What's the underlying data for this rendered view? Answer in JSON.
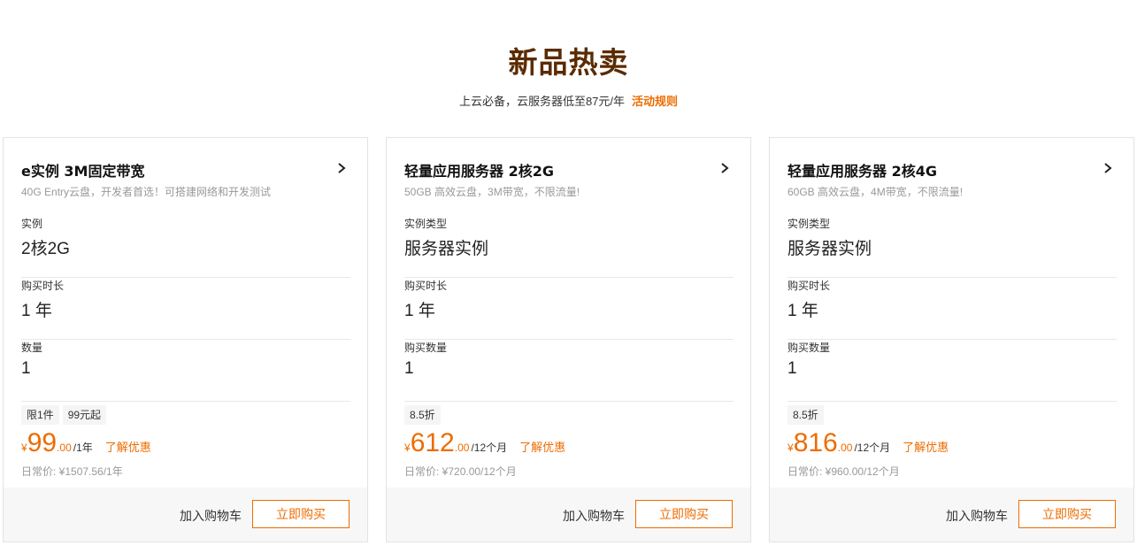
{
  "header": {
    "title": "新品热卖",
    "subtitle": "上云必备，云服务器低至87元/年",
    "rules_link": "活动规则"
  },
  "colors": {
    "accent": "#ed6c00",
    "title": "#5b2b00"
  },
  "cards": [
    {
      "title": "e实例 3M固定带宽",
      "desc": "40G Entry云盘，开发者首选！可搭建网络和开发测试",
      "fields": [
        {
          "label": "实例",
          "value": "2核2G"
        },
        {
          "label": "购买时长",
          "value": "1 年"
        },
        {
          "label": "数量",
          "value": "1"
        }
      ],
      "tags": [
        "限1件",
        "99元起"
      ],
      "price": {
        "symbol": "¥",
        "integer": "99",
        "decimal": ".00",
        "unit": "/1年"
      },
      "promo": "了解优惠",
      "regular": "日常价: ¥1507.56/1年",
      "cart": "加入购物车",
      "buy": "立即购买"
    },
    {
      "title": "轻量应用服务器 2核2G",
      "desc": "50GB 高效云盘，3M带宽，不限流量!",
      "fields": [
        {
          "label": "实例类型",
          "value": "服务器实例"
        },
        {
          "label": "购买时长",
          "value": "1 年"
        },
        {
          "label": "购买数量",
          "value": "1"
        }
      ],
      "tags": [
        "8.5折"
      ],
      "price": {
        "symbol": "¥",
        "integer": "612",
        "decimal": ".00",
        "unit": "/12个月"
      },
      "promo": "了解优惠",
      "regular": "日常价: ¥720.00/12个月",
      "cart": "加入购物车",
      "buy": "立即购买"
    },
    {
      "title": "轻量应用服务器 2核4G",
      "desc": "60GB 高效云盘，4M带宽，不限流量!",
      "fields": [
        {
          "label": "实例类型",
          "value": "服务器实例"
        },
        {
          "label": "购买时长",
          "value": "1 年"
        },
        {
          "label": "购买数量",
          "value": "1"
        }
      ],
      "tags": [
        "8.5折"
      ],
      "price": {
        "symbol": "¥",
        "integer": "816",
        "decimal": ".00",
        "unit": "/12个月"
      },
      "promo": "了解优惠",
      "regular": "日常价: ¥960.00/12个月",
      "cart": "加入购物车",
      "buy": "立即购买"
    }
  ]
}
